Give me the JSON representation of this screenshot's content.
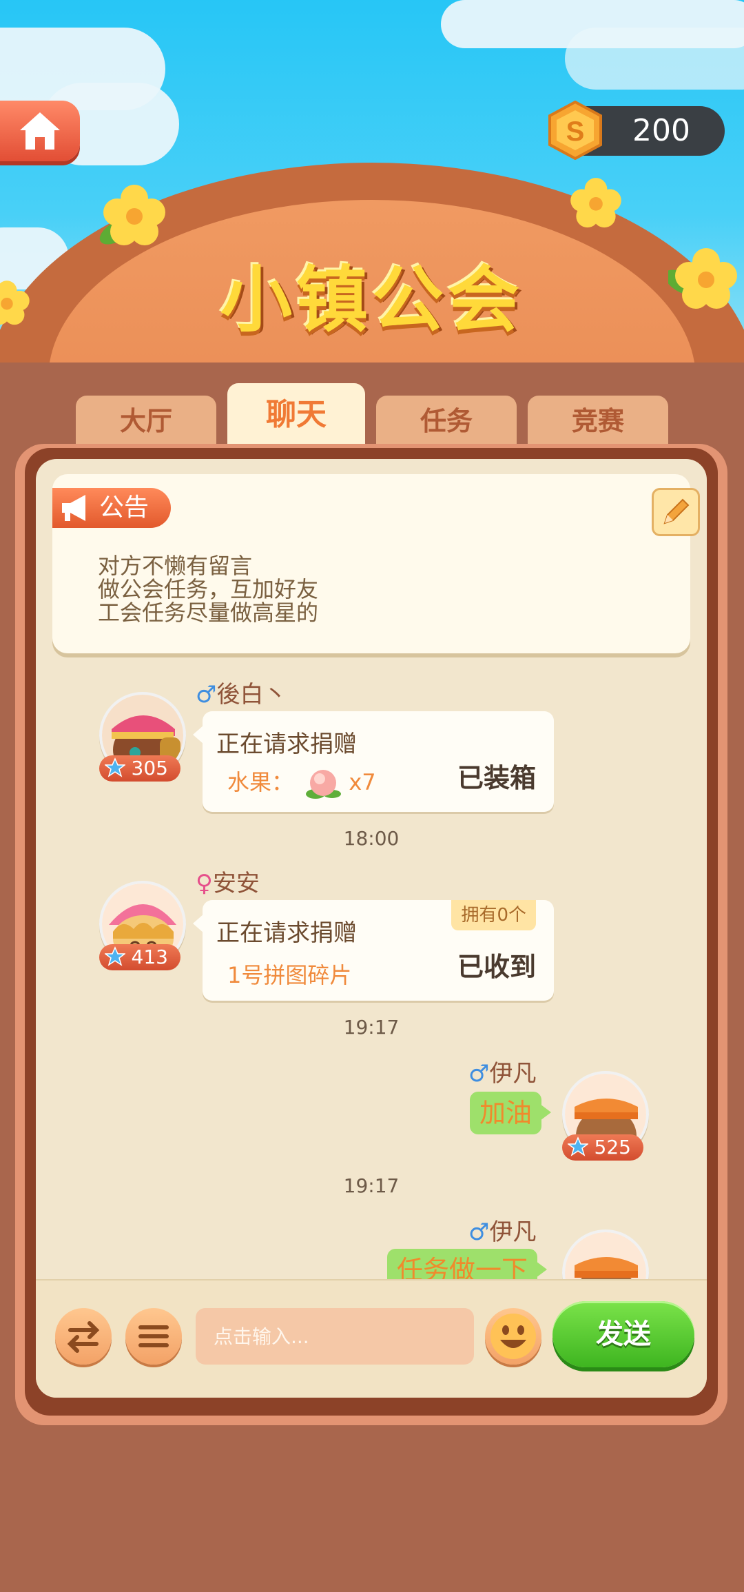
{
  "header": {
    "title": "小镇公会",
    "coins": "200"
  },
  "tabs": [
    {
      "label": "大厅",
      "active": false
    },
    {
      "label": "聊天",
      "active": true
    },
    {
      "label": "任务",
      "active": false
    },
    {
      "label": "竞赛",
      "active": false
    }
  ],
  "notice": {
    "badge": "公告",
    "text": "对方不懒有留言\n做公会任务，互加好友\n工会任务尽量做高星的"
  },
  "messages": [
    {
      "gender": "♂",
      "name": "後白丶",
      "level": "305",
      "title": "正在请求捐赠",
      "item": "水果：",
      "count": "x7",
      "status": "已装箱",
      "time": "18:00"
    },
    {
      "gender": "♀",
      "name": "安安",
      "level": "413",
      "title": "正在请求捐赠",
      "item": "1号拼图碎片",
      "owned": "拥有0个",
      "status": "已收到",
      "time": "19:17"
    },
    {
      "gender": "♂",
      "name": "伊凡",
      "level": "525",
      "text": "加油",
      "time": "19:17"
    },
    {
      "gender": "♂",
      "name": "伊凡",
      "text": "任务做一下"
    }
  ],
  "input": {
    "placeholder": "点击输入...",
    "send_label": "发送"
  },
  "colors": {
    "accent_orange": "#f07a35",
    "send_green": "#3eb520",
    "panel_brown": "#8c4228"
  }
}
